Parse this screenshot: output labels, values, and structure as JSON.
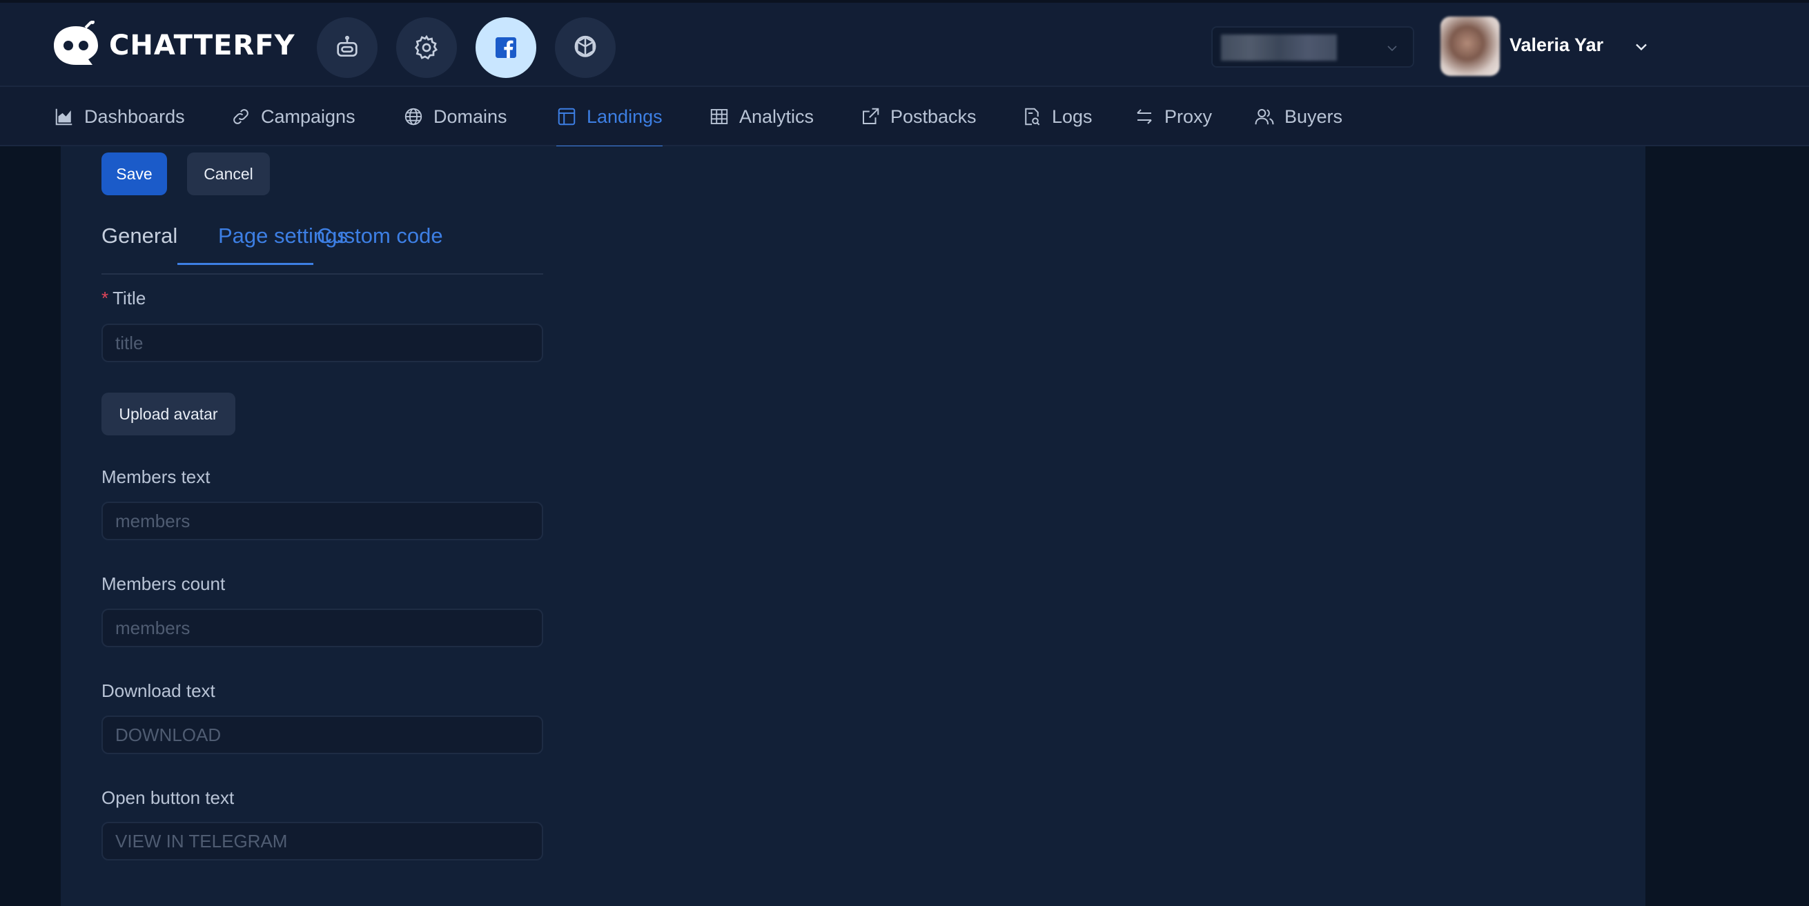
{
  "brand": {
    "name": "CHATTERFY"
  },
  "header": {
    "icon_buttons": [
      {
        "icon": "robot-icon"
      },
      {
        "icon": "gear-icon"
      },
      {
        "icon": "facebook-icon",
        "active": true
      },
      {
        "icon": "openai-icon"
      }
    ],
    "user": {
      "name": "Valeria Yar"
    }
  },
  "nav": {
    "items": [
      {
        "label": "Dashboards",
        "icon": "area-chart-icon"
      },
      {
        "label": "Campaigns",
        "icon": "link-icon"
      },
      {
        "label": "Domains",
        "icon": "globe-icon"
      },
      {
        "label": "Landings",
        "icon": "layout-icon",
        "active": true
      },
      {
        "label": "Analytics",
        "icon": "table-icon"
      },
      {
        "label": "Postbacks",
        "icon": "external-link-icon"
      },
      {
        "label": "Logs",
        "icon": "file-search-icon"
      },
      {
        "label": "Proxy",
        "icon": "swap-icon"
      },
      {
        "label": "Buyers",
        "icon": "users-icon"
      }
    ]
  },
  "actions": {
    "save": "Save",
    "cancel": "Cancel"
  },
  "tabs": [
    {
      "label": "General"
    },
    {
      "label": "Page settings",
      "active": true
    },
    {
      "label": "Custom code"
    }
  ],
  "form": {
    "title": {
      "required_mark": "*",
      "label": "Title",
      "placeholder": "title"
    },
    "upload_avatar": "Upload avatar",
    "members_text": {
      "label": "Members text",
      "placeholder": "members"
    },
    "members_count": {
      "label": "Members count",
      "placeholder": "members"
    },
    "download_text": {
      "label": "Download text",
      "placeholder": "DOWNLOAD"
    },
    "open_button_text": {
      "label": "Open button text",
      "placeholder": "VIEW IN TELEGRAM"
    }
  },
  "colors": {
    "accent": "#3d7fe4",
    "primary_button": "#1b5bc9",
    "header_bg": "#121e35",
    "content_bg": "#122037",
    "required": "#e2455a"
  }
}
